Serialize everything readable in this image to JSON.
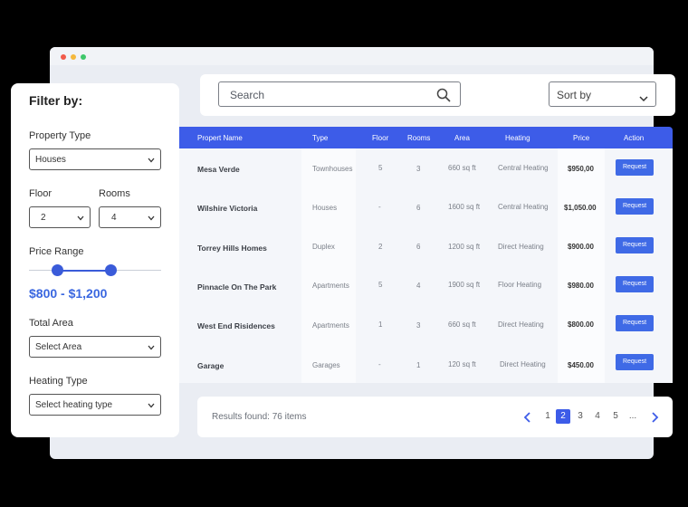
{
  "search": {
    "placeholder": "Search"
  },
  "sort": {
    "label": "Sort by"
  },
  "filter": {
    "title": "Filter by:",
    "property_type": {
      "label": "Property Type",
      "value": "Houses"
    },
    "floor": {
      "label": "Floor",
      "value": "2"
    },
    "rooms": {
      "label": "Rooms",
      "value": "4"
    },
    "price_range": {
      "label": "Price Range",
      "value": "$800 - $1,200"
    },
    "total_area": {
      "label": "Total Area",
      "value": "Select Area"
    },
    "heating_type": {
      "label": "Heating Type",
      "value": "Select heating type"
    }
  },
  "table": {
    "headers": {
      "name": "Propert Name",
      "type": "Type",
      "floor": "Floor",
      "rooms": "Rooms",
      "area": "Area",
      "heating": "Heating",
      "price": "Price",
      "action": "Action"
    },
    "rows": [
      {
        "name": "Mesa Verde",
        "type": "Townhouses",
        "floor": "5",
        "rooms": "3",
        "area": "660 sq ft",
        "heating": "Central Heating",
        "price": "$950,00",
        "action": "Request"
      },
      {
        "name": "Wilshire Victoria",
        "type": "Houses",
        "floor": "-",
        "rooms": "6",
        "area": "1600 sq ft",
        "heating": "Central Heating",
        "price": "$1,050.00",
        "action": "Request"
      },
      {
        "name": "Torrey Hills Homes",
        "type": "Duplex",
        "floor": "2",
        "rooms": "6",
        "area": "1200 sq ft",
        "heating": "Direct Heating",
        "price": "$900.00",
        "action": "Request"
      },
      {
        "name": "Pinnacle On The Park",
        "type": "Apartments",
        "floor": "5",
        "rooms": "4",
        "area": "1900 sq ft",
        "heating": "Floor Heating",
        "price": "$980.00",
        "action": "Request"
      },
      {
        "name": "West End Risidences",
        "type": "Apartments",
        "floor": "1",
        "rooms": "3",
        "area": "660 sq ft",
        "heating": "Direct Heating",
        "price": "$800.00",
        "action": "Request"
      },
      {
        "name": "Garage",
        "type": "Garages",
        "floor": "-",
        "rooms": "1",
        "area": "120 sq ft",
        "heating": "Direct Heating",
        "price": "$450.00",
        "action": "Request"
      }
    ]
  },
  "footer": {
    "results": "Results found:  76 items",
    "pages": [
      "1",
      "2",
      "3",
      "4",
      "5",
      "..."
    ],
    "active_page": "2"
  },
  "colors": {
    "accent": "#3d5ce8",
    "button": "#3f6ae6"
  }
}
